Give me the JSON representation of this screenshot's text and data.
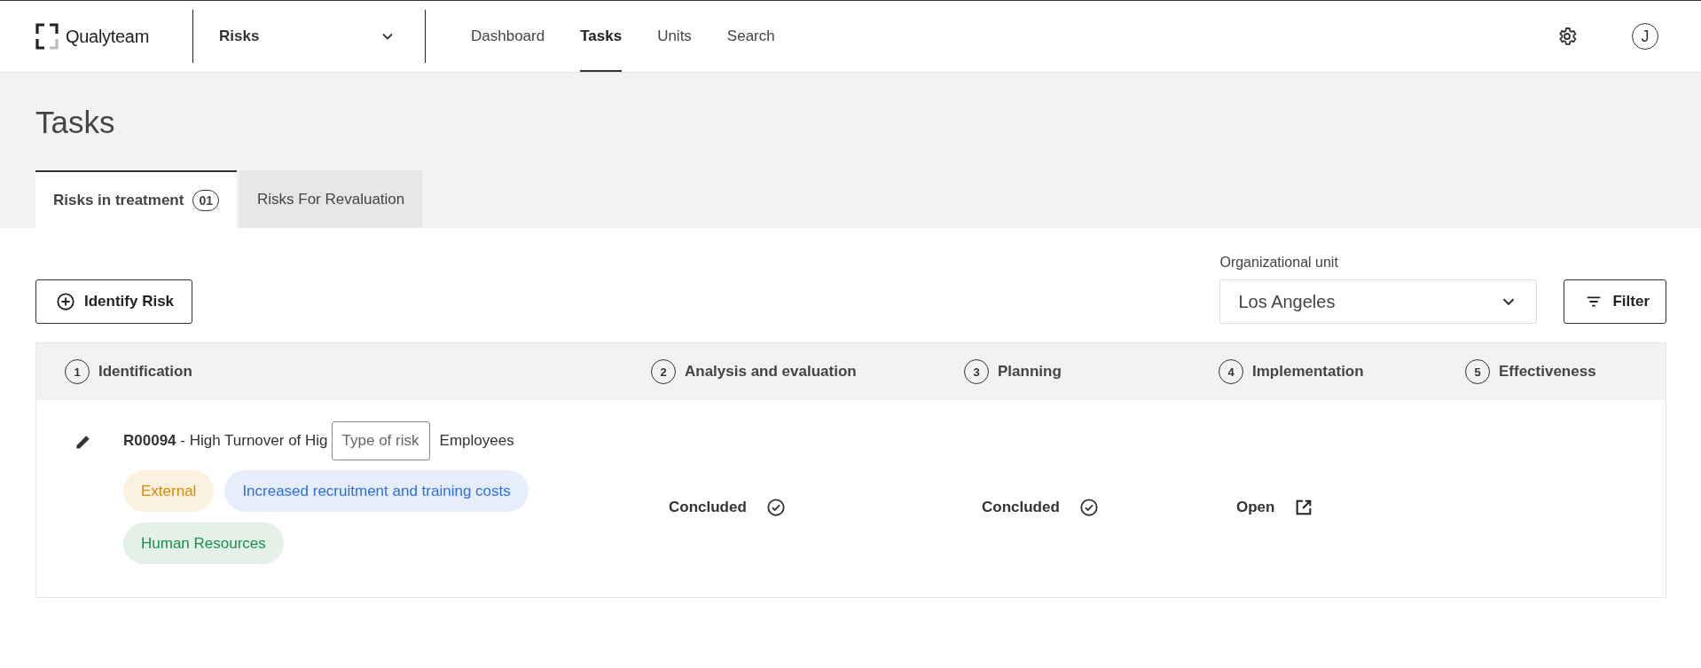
{
  "header": {
    "logo": "Qualyteam",
    "module_select": "Risks",
    "nav": [
      {
        "label": "Dashboard",
        "selected": false
      },
      {
        "label": "Tasks",
        "selected": true
      },
      {
        "label": "Units",
        "selected": false
      },
      {
        "label": "Search",
        "selected": false
      }
    ],
    "avatar": "J"
  },
  "page_title": "Tasks",
  "tabs": [
    {
      "label": "Risks in treatment",
      "count": "01",
      "selected": true
    },
    {
      "label": "Risks For Revaluation",
      "selected": false
    }
  ],
  "identify_button": "Identify Risk",
  "org_unit": {
    "label": "Organizational unit",
    "value": "Los Angeles"
  },
  "filter_button": "Filter",
  "table": {
    "columns": [
      {
        "step": "1",
        "label": "Identification"
      },
      {
        "step": "2",
        "label": "Analysis and evaluation"
      },
      {
        "step": "3",
        "label": "Planning"
      },
      {
        "step": "4",
        "label": "Implementation"
      },
      {
        "step": "5",
        "label": "Effectiveness"
      }
    ],
    "rows": [
      {
        "code": "R00094",
        "title_start": "- High Turnover of Hig",
        "title_end": "Employees",
        "tooltip": "Type of risk",
        "tags": [
          {
            "label": "External",
            "color": "#d98a00"
          },
          {
            "label": "Increased recruitment and training costs",
            "color": "#2f6fe0"
          },
          {
            "label": "Human Resources",
            "color": "#1a8f4c"
          }
        ],
        "stages": [
          {
            "kind": "concluded",
            "label": "Concluded"
          },
          {
            "kind": "concluded",
            "label": "Concluded"
          },
          {
            "kind": "open",
            "label": "Open"
          }
        ]
      }
    ]
  }
}
